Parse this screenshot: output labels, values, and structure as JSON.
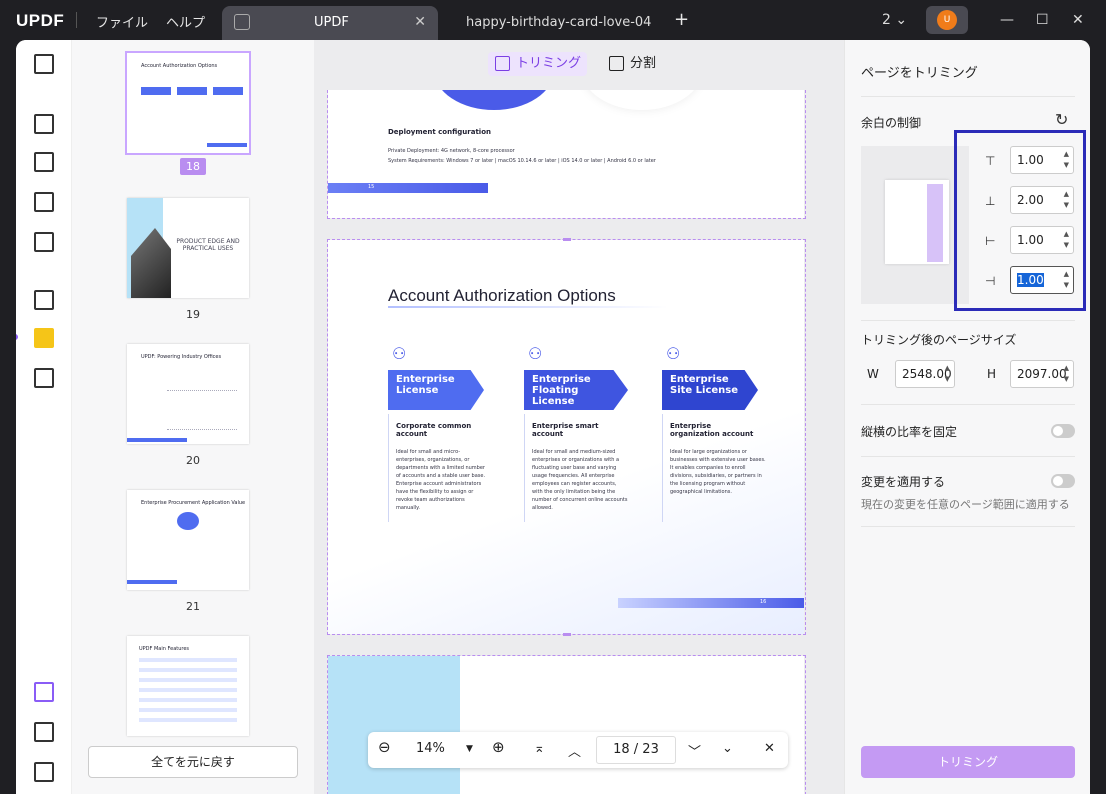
{
  "titlebar": {
    "logo": "UPDF",
    "menu": [
      "ファイル",
      "ヘルプ"
    ],
    "tabs": [
      {
        "label": "UPDF"
      },
      {
        "label": "happy-birthday-card-love-04"
      }
    ],
    "plus": "+",
    "window_count": "2",
    "avatar": "U"
  },
  "thumbnails": [
    {
      "num": "18",
      "title": "Account Authorization Options"
    },
    {
      "num": "19",
      "title": "PRODUCT EDGE AND PRACTICAL USES"
    },
    {
      "num": "20",
      "title": "UPDF: Powering Industry Offices"
    },
    {
      "num": "21",
      "title": "Enterprise Procurement Application Value"
    },
    {
      "num": "",
      "title": "UPDF Main Features"
    }
  ],
  "reset_button": "全てを元に戻す",
  "viewer": {
    "tab_crop": "トリミング",
    "tab_split": "分割",
    "page_top": {
      "heading": "Deployment configuration",
      "line1": "Private Deployment: 4G network, 8-core processor",
      "line2": "System Requirements: Windows 7 or later | macOS 10.14.6 or later | iOS 14.0 or later | Android 6.0 or later",
      "pnum": "15"
    },
    "page_main": {
      "title": "Account Authorization Options",
      "pnum": "16",
      "cards": [
        {
          "ribbon": "Enterprise License",
          "sub": "Corporate common account",
          "desc": "Ideal for small and micro-enterprises, organizations, or departments with a limited number of accounts and a stable user base. Enterprise account administrators have the flexibility to assign or revoke team authorizations manually."
        },
        {
          "ribbon": "Enterprise Floating License",
          "sub": "Enterprise smart account",
          "desc": "Ideal for small and medium-sized enterprises or organizations with a fluctuating user base and varying usage frequencies. All enterprise employees can register accounts, with the only limitation being the number of concurrent online accounts allowed."
        },
        {
          "ribbon": "Enterprise Site License",
          "sub": "Enterprise organization account",
          "desc": "Ideal for large organizations or businesses with extensive user bases. It enables companies to enroll divisions, subsidiaries, or partners in the licensing program without geographical limitations."
        }
      ]
    }
  },
  "zoom": {
    "value": "14%",
    "page": "18 / 23"
  },
  "right": {
    "title": "ページをトリミング",
    "margin_label": "余白の制御",
    "margins": [
      "1.00",
      "2.00",
      "1.00",
      "1.00"
    ],
    "size_label": "トリミング後のページサイズ",
    "w_label": "W",
    "w": "2548.00",
    "h_label": "H",
    "h": "2097.00",
    "ratio_label": "縦横の比率を固定",
    "apply_label": "変更を適用する",
    "apply_sub": "現在の変更を任意のページ範囲に適用する",
    "trim_button": "トリミング"
  }
}
